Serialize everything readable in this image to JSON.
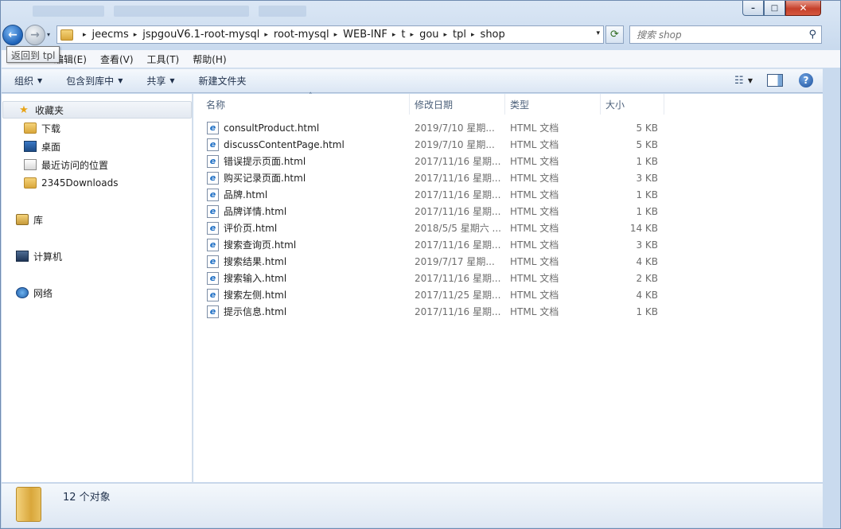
{
  "window": {
    "minimize": "–",
    "maximize": "□",
    "close": "✕"
  },
  "nav": {
    "back_glyph": "←",
    "forward_glyph": "→",
    "history_glyph": "▾",
    "tooltip": "返回到 tpl"
  },
  "address": {
    "crumbs": [
      "jeecms",
      "jspgouV6.1-root-mysql",
      "root-mysql",
      "WEB-INF",
      "t",
      "gou",
      "tpl",
      "shop"
    ],
    "separator": "▸",
    "dropdown_glyph": "▾",
    "refresh_glyph": "⟳"
  },
  "search": {
    "placeholder": "搜索 shop",
    "icon_glyph": "⚲"
  },
  "menubar": {
    "edit": "编辑(E)",
    "view": "查看(V)",
    "tools": "工具(T)",
    "help": "帮助(H)"
  },
  "toolbar": {
    "organize": "组织",
    "include_library": "包含到库中",
    "share": "共享",
    "new_folder": "新建文件夹",
    "dd_glyph": "▼",
    "view_glyph": "☷",
    "help_glyph": "?"
  },
  "navpane": {
    "favorites": "收藏夹",
    "favorites_items": [
      "下载",
      "桌面",
      "最近访问的位置",
      "2345Downloads"
    ],
    "libraries": "库",
    "computer": "计算机",
    "network": "网络",
    "star_glyph": "★"
  },
  "columns": {
    "name": "名称",
    "modified": "修改日期",
    "type": "类型",
    "size": "大小",
    "sort_glyph": "˄"
  },
  "files": [
    {
      "name": "consultProduct.html",
      "modified": "2019/7/10 星期...",
      "type": "HTML 文档",
      "size": "5 KB"
    },
    {
      "name": "discussContentPage.html",
      "modified": "2019/7/10 星期...",
      "type": "HTML 文档",
      "size": "5 KB"
    },
    {
      "name": "错误提示页面.html",
      "modified": "2017/11/16 星期...",
      "type": "HTML 文档",
      "size": "1 KB"
    },
    {
      "name": "购买记录页面.html",
      "modified": "2017/11/16 星期...",
      "type": "HTML 文档",
      "size": "3 KB"
    },
    {
      "name": "品牌.html",
      "modified": "2017/11/16 星期...",
      "type": "HTML 文档",
      "size": "1 KB"
    },
    {
      "name": "品牌详情.html",
      "modified": "2017/11/16 星期...",
      "type": "HTML 文档",
      "size": "1 KB"
    },
    {
      "name": "评价页.html",
      "modified": "2018/5/5 星期六 ...",
      "type": "HTML 文档",
      "size": "14 KB"
    },
    {
      "name": "搜索查询页.html",
      "modified": "2017/11/16 星期...",
      "type": "HTML 文档",
      "size": "3 KB"
    },
    {
      "name": "搜索结果.html",
      "modified": "2019/7/17 星期...",
      "type": "HTML 文档",
      "size": "4 KB"
    },
    {
      "name": "搜索输入.html",
      "modified": "2017/11/16 星期...",
      "type": "HTML 文档",
      "size": "2 KB"
    },
    {
      "name": "搜索左侧.html",
      "modified": "2017/11/25 星期...",
      "type": "HTML 文档",
      "size": "4 KB"
    },
    {
      "name": "提示信息.html",
      "modified": "2017/11/16 星期...",
      "type": "HTML 文档",
      "size": "1 KB"
    }
  ],
  "status": {
    "count_text": "12 个对象"
  }
}
